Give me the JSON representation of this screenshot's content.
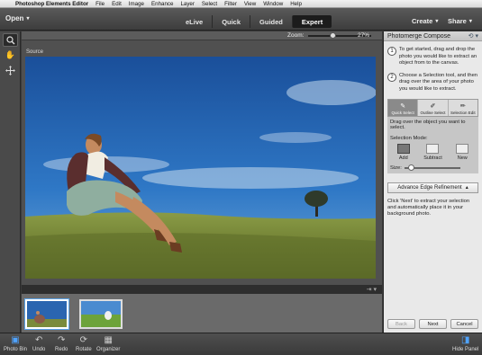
{
  "menubar": {
    "apple": "",
    "items": [
      "Photoshop Elements Editor",
      "File",
      "Edit",
      "Image",
      "Enhance",
      "Layer",
      "Select",
      "Filter",
      "View",
      "Window",
      "Help"
    ]
  },
  "topbar": {
    "open_label": "Open",
    "modes": [
      "eLive",
      "Quick",
      "Guided",
      "Expert"
    ],
    "active_mode": "Expert",
    "create_label": "Create",
    "share_label": "Share"
  },
  "canvas": {
    "zoom_label": "Zoom:",
    "zoom_value": "27%",
    "zoom_fraction": 0.27,
    "source_label": "Source"
  },
  "panel": {
    "title": "Photomerge Compose",
    "step1_num": "1",
    "step1_text": "To get started, drag and drop the photo you would like to extract an object from to the canvas.",
    "step2_num": "2",
    "step2_text": "Choose a Selection tool, and then drag over the area of your photo you would like to extract.",
    "tabs": [
      "Quick Select",
      "Outline Select",
      "Selection Edit"
    ],
    "hint": "Drag over the object you want to select.",
    "selection_mode_label": "Selection Mode:",
    "modes": [
      "Add",
      "Subtract",
      "New"
    ],
    "size_label": "Size:",
    "adv_button": "Advance Edge Refinement",
    "final_hint": "Click 'Next' to extract your selection and automatically place it in your background photo.",
    "back_label": "Back",
    "next_label": "Next",
    "cancel_label": "Cancel"
  },
  "taskbar": {
    "items": [
      "Photo Bin",
      "Undo",
      "Redo",
      "Rotate",
      "Organizer"
    ],
    "hide_panel": "Hide Panel"
  },
  "colors": {
    "accent": "#4fa3ff",
    "topbar": "#4a4a4a",
    "panel": "#e9e9e9",
    "sky": "#1f5fae",
    "grass": "#7e8f3a"
  }
}
